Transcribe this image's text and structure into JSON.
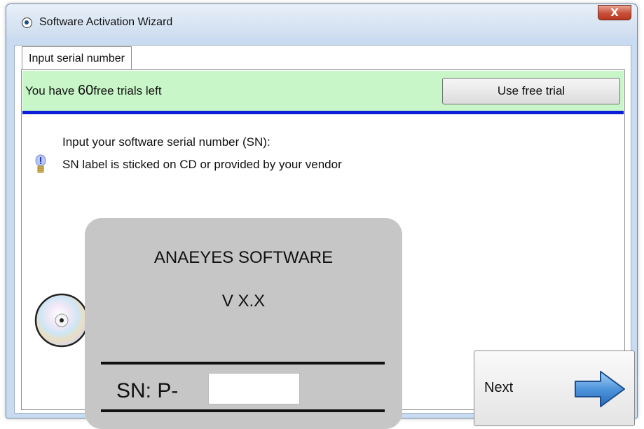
{
  "window": {
    "title": "Software Activation Wizard",
    "close_glyph": "X"
  },
  "tab": {
    "label": "Input serial number"
  },
  "trial": {
    "prefix": "You have ",
    "count": "60",
    "suffix": "free trials left",
    "button_label": "Use free trial",
    "bar_color": "#c8f6c8",
    "divider_color": "#0c1fd8"
  },
  "serial": {
    "instruction": "Input your software serial number (SN):",
    "hint": "SN label is sticked on CD or provided by your vendor",
    "prefix_label": "SN: P-",
    "input_value": ""
  },
  "cd_label": {
    "brand": "ANAEYES SOFTWARE",
    "version": "V X.X"
  },
  "navigation": {
    "next_label": "Next"
  },
  "icons": {
    "app": "radio-button-icon",
    "close": "close-icon",
    "tip": "lightbulb-icon",
    "disc": "cd-disc-icon",
    "next": "arrow-right-icon"
  }
}
